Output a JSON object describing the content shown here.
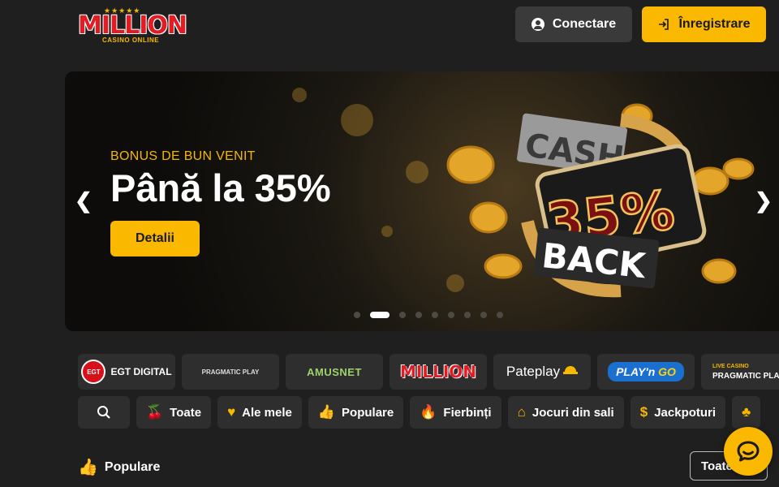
{
  "header": {
    "logo": {
      "word": "MILLION",
      "sub": "CASINO ONLINE",
      "stars": "★★★★★"
    },
    "login_label": "Conectare",
    "register_label": "Înregistrare"
  },
  "banner": {
    "eyebrow": "BONUS DE BUN VENIT",
    "headline": "Până la 35%",
    "details_label": "Detalii",
    "prev_arrow": "❮",
    "next_arrow": "❯",
    "slide_count": 9,
    "active_slide": 2,
    "art": {
      "cash": "CASH",
      "percent": "35%",
      "back": "BACK"
    }
  },
  "providers": [
    {
      "name": "EGT DIGITAL",
      "badge": "EGT"
    },
    {
      "name": "PRAGMATIC PLAY"
    },
    {
      "name": "AMUSNET"
    },
    {
      "name": "MILLION"
    },
    {
      "name": "Pateplay"
    },
    {
      "name": "PLAY'n GO",
      "pre": "PLAY'n ",
      "go": "GO"
    },
    {
      "name": "PRAGMATIC PLA",
      "tag": "LIVE CASINO"
    }
  ],
  "categories": [
    {
      "label": "Toate",
      "icon": "🍒"
    },
    {
      "label": "Ale mele",
      "icon": "♥"
    },
    {
      "label": "Populare",
      "icon": "👍"
    },
    {
      "label": "Fierbinți",
      "icon": "🔥"
    },
    {
      "label": "Jocuri din sali",
      "icon": "⌂"
    },
    {
      "label": "Jackpoturi",
      "icon": "$"
    },
    {
      "label": "",
      "icon": "♣"
    }
  ],
  "section": {
    "title": "Populare",
    "see_all_label": "Toate"
  },
  "colors": {
    "accent": "#fbb800",
    "background": "#1f1f1f",
    "tile": "#2e2e2e",
    "brand_red": "#e31b23"
  }
}
